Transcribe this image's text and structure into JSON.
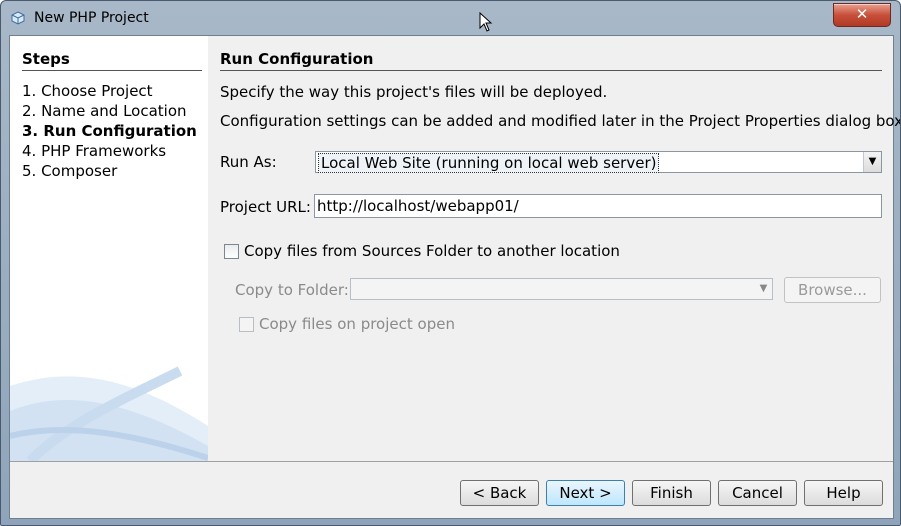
{
  "window": {
    "title": "New PHP Project",
    "close_label": "✕"
  },
  "steps": {
    "title": "Steps",
    "items": [
      {
        "label": "1.  Choose Project"
      },
      {
        "label": "2.  Name and Location"
      },
      {
        "label": "3.  Run Configuration"
      },
      {
        "label": "4.  PHP Frameworks"
      },
      {
        "label": "5.  Composer"
      }
    ],
    "active_index": 2
  },
  "panel": {
    "title": "Run Configuration",
    "desc1": "Specify the way this project's files will be deployed.",
    "desc2": "Configuration settings can be added and modified later in the Project Properties dialog box.",
    "run_as_label": "Run As:",
    "run_as_value": "Local Web Site (running on local web server)",
    "project_url_label": "Project URL:",
    "project_url_value": "http://localhost/webapp01/",
    "copy_files_label": "Copy files from Sources Folder to another location",
    "copy_to_folder_label": "Copy to Folder:",
    "copy_to_folder_value": "",
    "browse_label": "Browse...",
    "copy_on_open_label": "Copy files on project open"
  },
  "buttons": {
    "back": "< Back",
    "next": "Next >",
    "finish": "Finish",
    "cancel": "Cancel",
    "help": "Help"
  }
}
